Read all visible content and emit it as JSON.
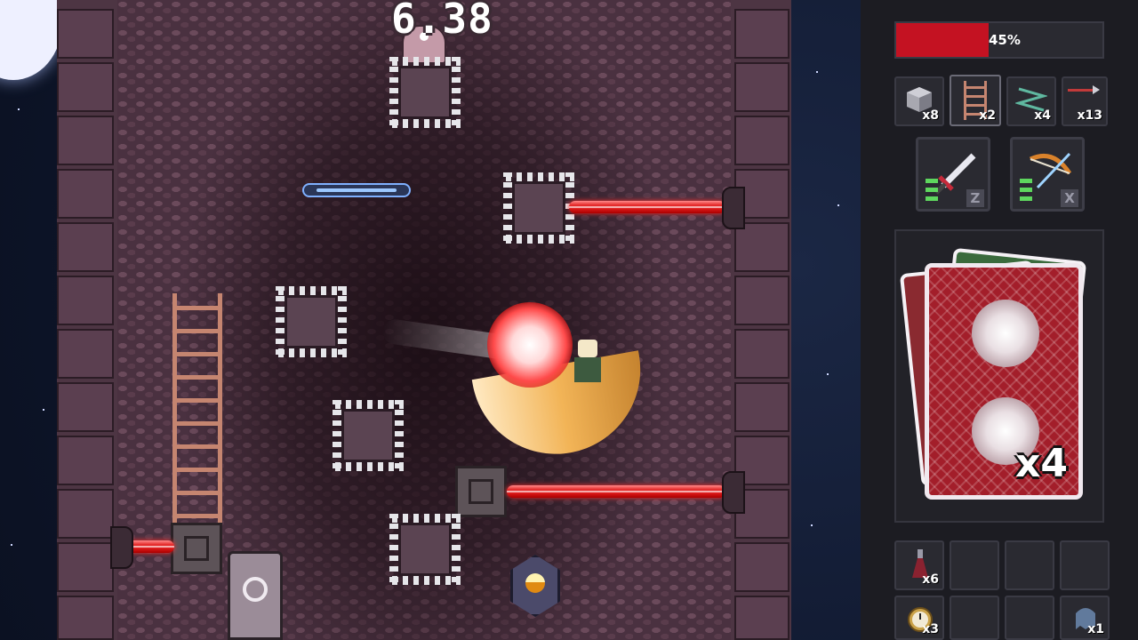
{
  "hud": {
    "timer": "6.38",
    "health": {
      "percent": 45,
      "label": "45%",
      "color": "#c41222"
    }
  },
  "inventory": {
    "blocks": [
      {
        "icon": "stone-block-icon",
        "count": "x8"
      },
      {
        "icon": "ladder-icon",
        "count": "x2"
      },
      {
        "icon": "spring-icon",
        "count": "x4"
      },
      {
        "icon": "arrow-trap-icon",
        "count": "x13"
      }
    ],
    "weapons": [
      {
        "icon": "sword-icon",
        "key": "Z"
      },
      {
        "icon": "bow-icon",
        "key": "X"
      }
    ],
    "card": {
      "icon": "playing-card-icon",
      "count": "x4"
    },
    "items": [
      {
        "icon": "potion-icon",
        "count": "x6"
      },
      {
        "icon": "pocket-watch-icon",
        "count": "x3"
      },
      {
        "icon": "ghost-icon",
        "count": "x1"
      }
    ]
  },
  "colors": {
    "laser": "#e01a1a",
    "tower": "#4a3140",
    "panel": "#1c1c22"
  }
}
